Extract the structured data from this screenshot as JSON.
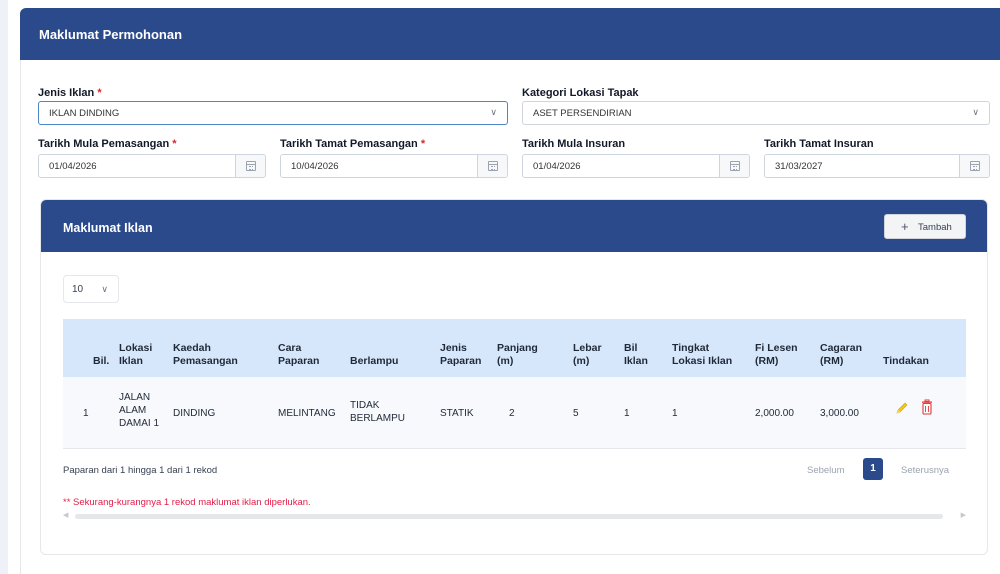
{
  "header": {
    "title": "Maklumat Permohonan"
  },
  "form": {
    "jenis_iklan": {
      "label": "Jenis Iklan",
      "required_mark": "*",
      "value": "IKLAN DINDING"
    },
    "kategori_lokasi": {
      "label": "Kategori Lokasi Tapak",
      "value": "ASET PERSENDIRIAN"
    },
    "tarikh_mula_pemasangan": {
      "label": "Tarikh Mula Pemasangan",
      "required_mark": "*",
      "value": "01/04/2026"
    },
    "tarikh_tamat_pemasangan": {
      "label": "Tarikh Tamat Pemasangan",
      "required_mark": "*",
      "value": "10/04/2026"
    },
    "tarikh_mula_insuran": {
      "label": "Tarikh Mula Insuran",
      "value": "01/04/2026"
    },
    "tarikh_tamat_insuran": {
      "label": "Tarikh Tamat Insuran",
      "value": "31/03/2027"
    }
  },
  "iklan": {
    "title": "Maklumat Iklan",
    "add_button": {
      "icon": "+",
      "label": "Tambah"
    },
    "page_size": "10",
    "columns": {
      "bil": "Bil.",
      "lokasi": [
        "Lokasi",
        "Iklan"
      ],
      "kaedah": [
        "Kaedah",
        "Pemasangan"
      ],
      "cara": [
        "Cara",
        "Paparan"
      ],
      "berlampu": "Berlampu",
      "jenis_paparan": [
        "Jenis",
        "Paparan"
      ],
      "panjang": [
        "Panjang",
        "(m)"
      ],
      "lebar": [
        "Lebar",
        "(m)"
      ],
      "bil_iklan": [
        "Bil",
        "Iklan"
      ],
      "tingkat": [
        "Tingkat",
        "Lokasi Iklan"
      ],
      "fi_lesen": [
        "Fi Lesen",
        "(RM)"
      ],
      "cagaran": [
        "Cagaran",
        "(RM)"
      ],
      "tindakan": "Tindakan"
    },
    "rows": [
      {
        "bil": "1",
        "lokasi": [
          "JALAN",
          "ALAM",
          "DAMAI 1"
        ],
        "kaedah": "DINDING",
        "cara": "MELINTANG",
        "berlampu": [
          "TIDAK",
          "BERLAMPU"
        ],
        "jenis_paparan": "STATIK",
        "panjang": "2",
        "lebar": "5",
        "bil_iklan": "1",
        "tingkat": "1",
        "fi_lesen": "2,000.00",
        "cagaran": "3,000.00"
      }
    ],
    "info": "Paparan dari 1 hingga 1 dari 1 rekod",
    "pager": {
      "prev": "Sebelum",
      "current": "1",
      "next": "Seterusnya"
    },
    "warning": "** Sekurang-kurangnya 1 rekod maklumat iklan diperlukan."
  },
  "icons": {
    "dropdown": "chevron-down-icon",
    "calendar": "calendar-icon",
    "edit": "pencil-icon",
    "delete": "trash-icon"
  },
  "colors": {
    "primary": "#2b4a8b",
    "table_header": "#d6e6fb",
    "required": "#dc2626",
    "warning": "#e11d48",
    "edit_icon": "#f5c518",
    "delete_icon": "#e53935"
  }
}
